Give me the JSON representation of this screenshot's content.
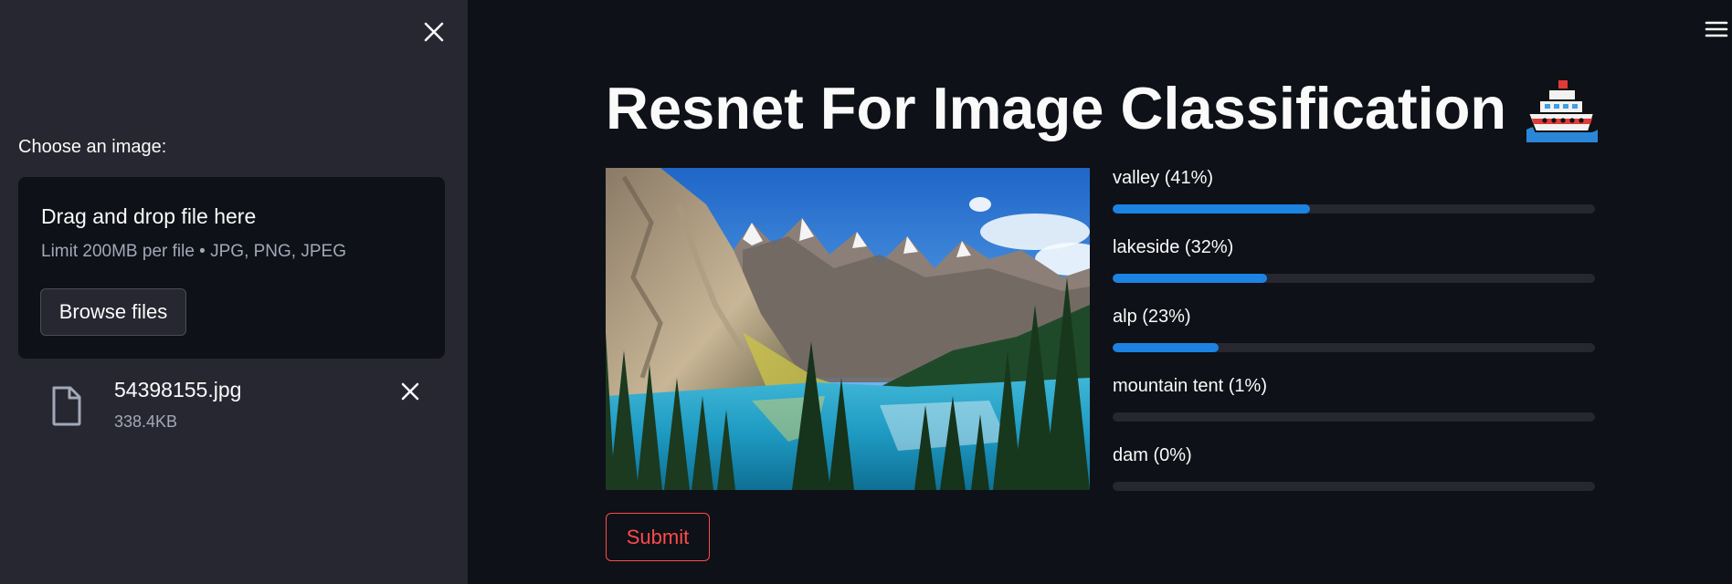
{
  "sidebar": {
    "uploader_label": "Choose an image:",
    "dropzone_title": "Drag and drop file here",
    "dropzone_limit": "Limit 200MB per file • JPG, PNG, JPEG",
    "browse_label": "Browse files",
    "file": {
      "name": "54398155.jpg",
      "size": "338.4KB"
    }
  },
  "main": {
    "title": "Resnet For Image Classification",
    "title_emoji": "ship-emoji",
    "image_alt": "mountain lake landscape",
    "predictions": [
      {
        "label": "valley (41%)",
        "value": 0.41
      },
      {
        "label": "lakeside (32%)",
        "value": 0.32
      },
      {
        "label": "alp (23%)",
        "value": 0.22
      },
      {
        "label": "mountain tent (1%)",
        "value": 0.0
      },
      {
        "label": "dam (0%)",
        "value": 0.0
      }
    ],
    "submit_label": "Submit"
  },
  "colors": {
    "background": "#0e1117",
    "sidebar": "#262730",
    "progress": "#1c83e1",
    "submit_accent": "#ff4b4b"
  },
  "icons": {
    "sidebar_close": "close-icon",
    "file": "file-icon",
    "file_remove": "close-icon",
    "menu": "hamburger-menu-icon"
  }
}
